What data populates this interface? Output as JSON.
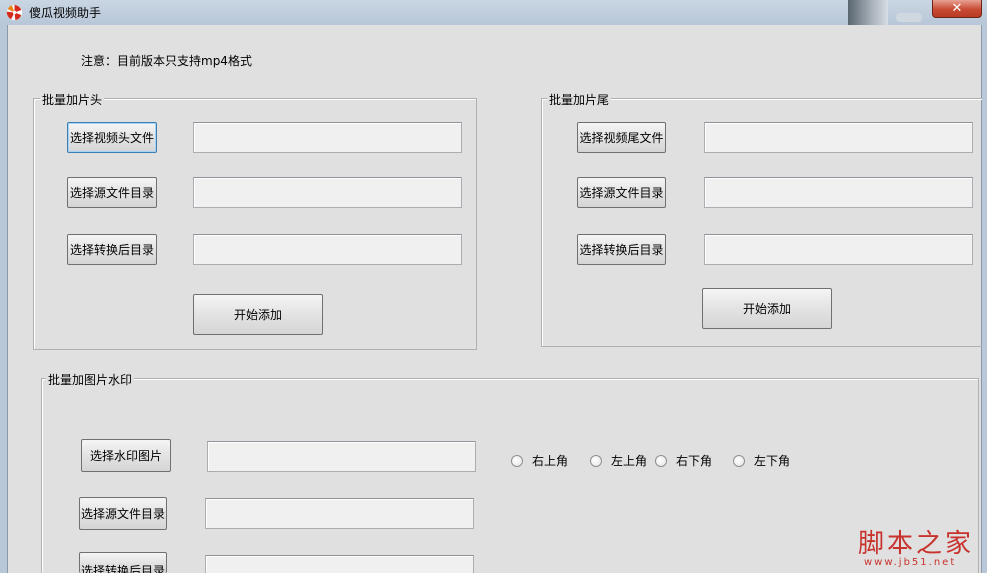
{
  "window": {
    "title": "傻瓜视频助手",
    "close_glyph": "✕",
    "icon": "app-pinwheel-icon"
  },
  "notice": "注意：目前版本只支持mp4格式",
  "header_group": {
    "legend": "批量加片头",
    "select_file_button": "选择视频头文件",
    "select_source_button": "选择源文件目录",
    "select_output_button": "选择转换后目录",
    "file_value": "",
    "source_value": "",
    "output_value": "",
    "start_button": "开始添加"
  },
  "trailer_group": {
    "legend": "批量加片尾",
    "select_file_button": "选择视频尾文件",
    "select_source_button": "选择源文件目录",
    "select_output_button": "选择转换后目录",
    "file_value": "",
    "source_value": "",
    "output_value": "",
    "start_button": "开始添加"
  },
  "watermark_group": {
    "legend": "批量加图片水印",
    "select_image_button": "选择水印图片",
    "select_source_button": "选择源文件目录",
    "select_output_button": "选择转换后目录",
    "image_value": "",
    "source_value": "",
    "output_value": "",
    "positions": [
      "右上角",
      "左上角",
      "右下角",
      "左下角"
    ]
  },
  "site_watermark": {
    "text": "脚本之家",
    "url": "www.jb51.net"
  },
  "colors": {
    "title_bar": "#c3d1e0",
    "client_bg": "#e0e0e0",
    "close_red": "#c84a33",
    "watermark_red": "#c8322c"
  }
}
